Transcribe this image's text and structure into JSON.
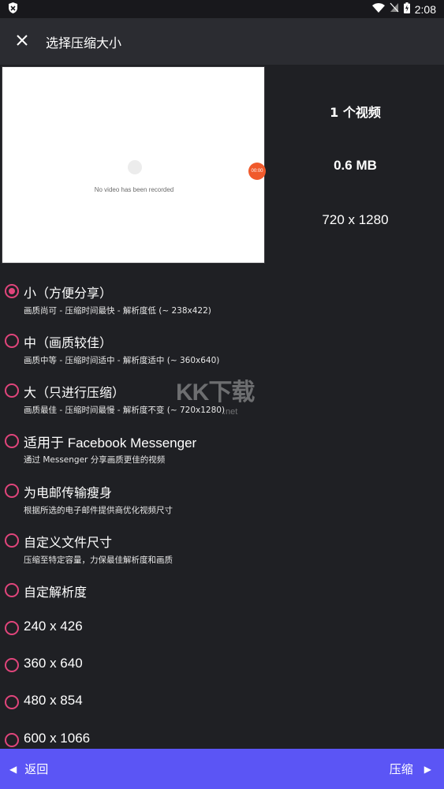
{
  "status_bar": {
    "time": "2:08",
    "icons": [
      "shield-app-icon",
      "wifi-icon",
      "no-sim-icon",
      "battery-charging-icon"
    ]
  },
  "app_bar": {
    "close_icon": "close-icon",
    "title": "选择压缩大小"
  },
  "preview": {
    "placeholder_text": "No video has been recorded",
    "record_time": "00:00"
  },
  "info": {
    "video_count": "1 个视频",
    "size": "0.6 MB",
    "resolution": "720 x 1280"
  },
  "options": [
    {
      "title": "小（方便分享）",
      "desc": "画质尚可 - 压缩时间最快 - 解析度低 (~ 238x422)",
      "selected": true
    },
    {
      "title": "中（画质较佳）",
      "desc": "画质中等 - 压缩时间适中 - 解析度适中 (~ 360x640)",
      "selected": false
    },
    {
      "title": "大（只进行压缩）",
      "desc": "画质最佳 - 压缩时间最慢 - 解析度不变 (~ 720x1280)",
      "selected": false
    },
    {
      "title": "适用于 Facebook Messenger",
      "desc": "通过 Messenger 分享画质更佳的视频",
      "selected": false
    },
    {
      "title": "为电邮传输瘦身",
      "desc": "根据所选的电子邮件提供商优化视频尺寸",
      "selected": false
    },
    {
      "title": "自定义文件尺寸",
      "desc": "压缩至特定容量，力保最佳解析度和画质",
      "selected": false
    },
    {
      "title": "自定解析度",
      "desc": "",
      "selected": false
    },
    {
      "title": "240 x 426",
      "desc": "",
      "selected": false
    },
    {
      "title": "360 x 640",
      "desc": "",
      "selected": false
    },
    {
      "title": "480 x 854",
      "desc": "",
      "selected": false
    },
    {
      "title": "600 x 1066",
      "desc": "",
      "selected": false
    }
  ],
  "watermark": {
    "main": "KK下载",
    "sub": ".net"
  },
  "bottom_bar": {
    "back_label": "返回",
    "compress_label": "压缩"
  },
  "colors": {
    "accent": "#e0457b",
    "bottom_bar": "#5b55f5",
    "background": "#1f2024",
    "app_bar": "#2b2c31"
  }
}
